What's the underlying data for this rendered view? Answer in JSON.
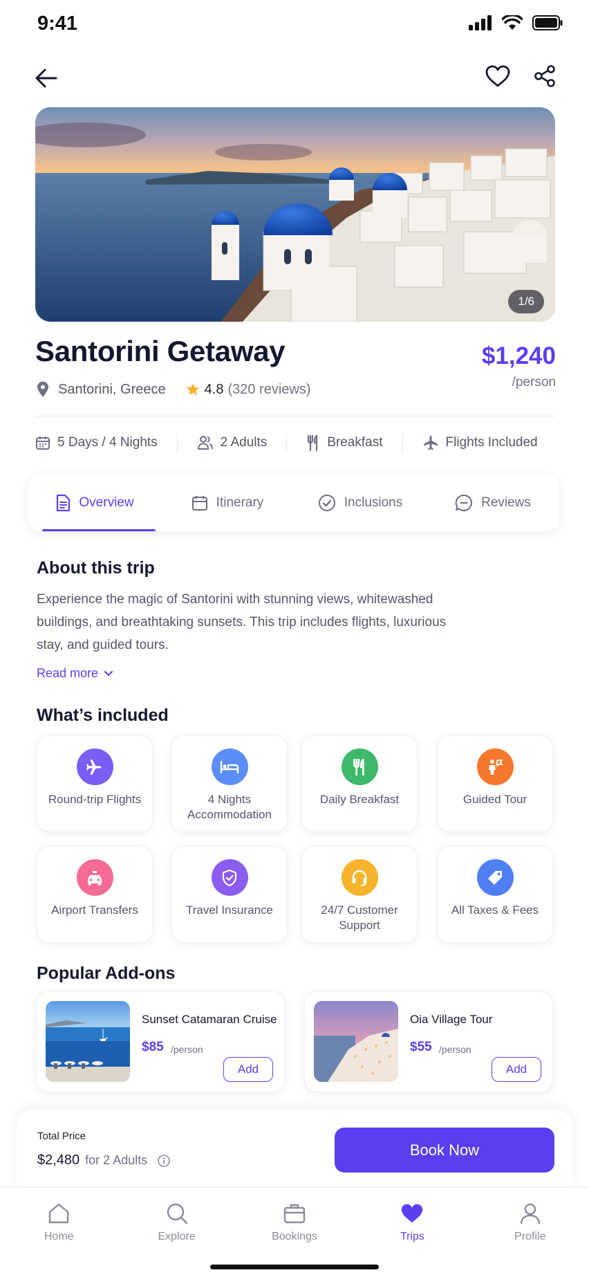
{
  "status_bar": {
    "time": "9:41"
  },
  "hero": {
    "counter": "1/6"
  },
  "trip": {
    "title": "Santorini Getaway",
    "price": "$1,240",
    "per": "/person",
    "location": "Santorini, Greece",
    "rating": "4.8",
    "reviews": "(320 reviews)"
  },
  "features": [
    "5 Days / 4 Nights",
    "2 Adults",
    "Breakfast",
    "Flights Included"
  ],
  "tabs": [
    {
      "label": "Overview",
      "active": true
    },
    {
      "label": "Itinerary",
      "active": false
    },
    {
      "label": "Inclusions",
      "active": false
    },
    {
      "label": "Reviews",
      "active": false
    }
  ],
  "about": {
    "heading": "About this trip",
    "text": "Experience the magic of Santorini with stunning views, whitewashed buildings, and breathtaking sunsets. This trip includes flights, luxurious stay, and guided tours.",
    "read_more": "Read more"
  },
  "included": {
    "heading": "What’s included",
    "items": [
      {
        "label": "Round-trip Flights",
        "icon": "airplane-icon",
        "color": "#7b5cf5"
      },
      {
        "label": "4 Nights Accommodation",
        "icon": "bed-icon",
        "color": "#5b8df6"
      },
      {
        "label": "Daily Breakfast",
        "icon": "utensils-icon",
        "color": "#3fb86b"
      },
      {
        "label": "Guided Tour",
        "icon": "guide-icon",
        "color": "#f5782b"
      },
      {
        "label": "Airport Transfers",
        "icon": "taxi-icon",
        "color": "#f56b95"
      },
      {
        "label": "Travel Insurance",
        "icon": "shield-icon",
        "color": "#8b5cf0"
      },
      {
        "label": "24/7 Customer Support",
        "icon": "headset-icon",
        "color": "#f5b42b"
      },
      {
        "label": "All Taxes & Fees",
        "icon": "tag-icon",
        "color": "#4f7ff2"
      }
    ]
  },
  "addons": {
    "heading": "Popular Add-ons",
    "items": [
      {
        "name": "Sunset Catamaran Cruise",
        "price": "$85",
        "per": "/person",
        "button": "Add"
      },
      {
        "name": "Oia Village Tour",
        "price": "$55",
        "per": "/person",
        "button": "Add"
      }
    ]
  },
  "booking": {
    "total_label": "Total Price",
    "total_value": "$2,480",
    "total_sub": "for 2 Adults",
    "button": "Book Now"
  },
  "nav": [
    {
      "label": "Home",
      "active": false
    },
    {
      "label": "Explore",
      "active": false
    },
    {
      "label": "Bookings",
      "active": false
    },
    {
      "label": "Trips",
      "active": true
    },
    {
      "label": "Profile",
      "active": false
    }
  ],
  "colors": {
    "accent": "#5b3ef0",
    "star": "#f5b42b"
  }
}
